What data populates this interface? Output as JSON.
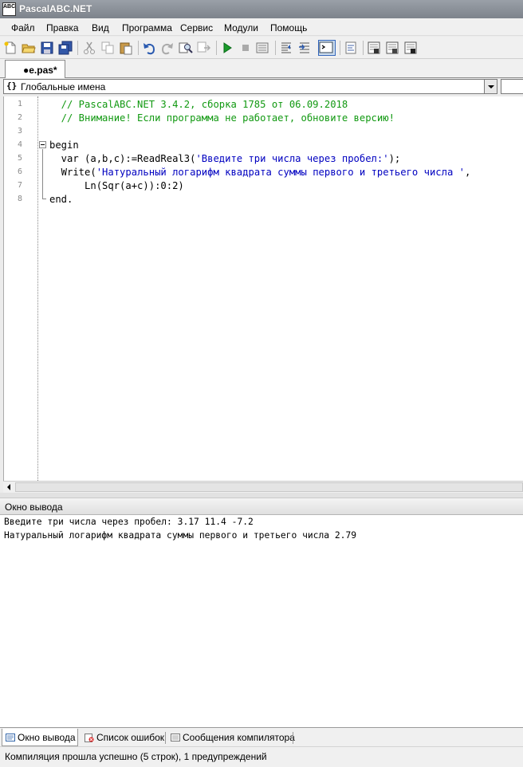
{
  "window": {
    "title": "PascalABC.NET",
    "app_icon_text": "ABC"
  },
  "menu": [
    "Файл",
    "Правка",
    "Вид",
    "Программа",
    "Сервис",
    "Модули",
    "Помощь"
  ],
  "toolbar": {
    "icons": [
      "new-file-icon",
      "open-file-icon",
      "save-icon",
      "save-all-icon",
      "cut-icon",
      "copy-icon",
      "paste-icon",
      "undo-icon",
      "redo-icon",
      "find-icon",
      "replace-icon",
      "run-icon",
      "stop-icon",
      "compile-icon",
      "step-into-icon",
      "step-over-icon",
      "output-window-icon",
      "format-code-icon",
      "debug-window-icon",
      "local-vars-icon",
      "watch-icon"
    ],
    "active": "output-window-icon"
  },
  "editor_tab": {
    "label": "●e.pas*",
    "modified": true
  },
  "navigation": {
    "icon": "{}",
    "label": "Глобальные имена"
  },
  "code": {
    "line_numbers": [
      "1",
      "2",
      "3",
      "4",
      "5",
      "6",
      "7",
      "8"
    ],
    "lines": [
      {
        "segments": [
          {
            "t": "  // PascalABC.NET 3.4.2, сборка 1785 от 06.09.2018",
            "c": "comment"
          }
        ]
      },
      {
        "segments": [
          {
            "t": "  // Внимание! Если программа не работает, обновите версию!",
            "c": "comment"
          }
        ]
      },
      {
        "segments": []
      },
      {
        "segments": [
          {
            "t": "begin",
            "c": "kw"
          }
        ]
      },
      {
        "segments": [
          {
            "t": "  var (a,b,c):=ReadReal3(",
            "c": "kw"
          },
          {
            "t": "'Введите три числа через пробел:'",
            "c": "str"
          },
          {
            "t": ");",
            "c": "kw"
          }
        ]
      },
      {
        "segments": [
          {
            "t": "  Write(",
            "c": "kw"
          },
          {
            "t": "'Натуральный логарифм квадрата суммы первого и третьего числа '",
            "c": "str"
          },
          {
            "t": ",",
            "c": "kw"
          }
        ]
      },
      {
        "segments": [
          {
            "t": "      Ln(Sqr(a+c)):0:2)",
            "c": "kw"
          }
        ]
      },
      {
        "segments": [
          {
            "t": "end.",
            "c": "kw"
          }
        ]
      }
    ]
  },
  "output": {
    "title": "Окно вывода",
    "lines": [
      "Введите три числа через пробел: 3.17 11.4 -7.2",
      "Натуральный логарифм квадрата суммы первого и третьего числа 2.79"
    ]
  },
  "bottom_tabs": [
    {
      "label": "Окно вывода",
      "icon": "output-window-icon",
      "active": true
    },
    {
      "label": "Список ошибок",
      "icon": "error-list-icon",
      "active": false
    },
    {
      "label": "Сообщения компилятора",
      "icon": "compiler-messages-icon",
      "active": false
    }
  ],
  "status": {
    "text": "Компиляция прошла успешно (5 строк), 1 предупреждений"
  }
}
